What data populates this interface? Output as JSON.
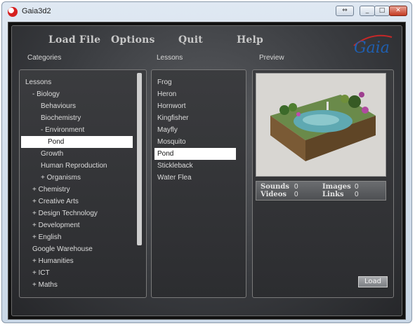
{
  "window": {
    "title": "Gaia3d2"
  },
  "menu": {
    "load_file": "Load File",
    "options": "Options",
    "quit": "Quit",
    "help": "Help"
  },
  "logo": {
    "text": "Gaia"
  },
  "columns": {
    "categories": "Categories",
    "lessons": "Lessons",
    "preview": "Preview"
  },
  "categories": [
    "Lessons",
    "- Biology",
    "Behaviours",
    "Biochemistry",
    "- Environment",
    "Pond",
    "Growth",
    "Human Reproduction",
    "+ Organisms",
    "+ Chemistry",
    "+ Creative Arts",
    "+ Design Technology",
    "+ Development",
    "+ English",
    "Google Warehouse",
    "+ Humanities",
    "+ ICT",
    "+ Maths"
  ],
  "categories_selected": "Pond",
  "lessons": [
    "Frog",
    "Heron",
    "Hornwort",
    "Kingfisher",
    "Mayfly",
    "Mosquito",
    "Pond",
    "Stickleback",
    "Water Flea"
  ],
  "lessons_selected": "Pond",
  "stats": {
    "sounds_label": "Sounds",
    "sounds": "0",
    "images_label": "Images",
    "images": "0",
    "videos_label": "Videos",
    "videos": "0",
    "links_label": "Links",
    "links": "0"
  },
  "load_button": "Load",
  "colors": {
    "accent_blue": "#1f5fb0",
    "logo_red": "#c62828"
  }
}
